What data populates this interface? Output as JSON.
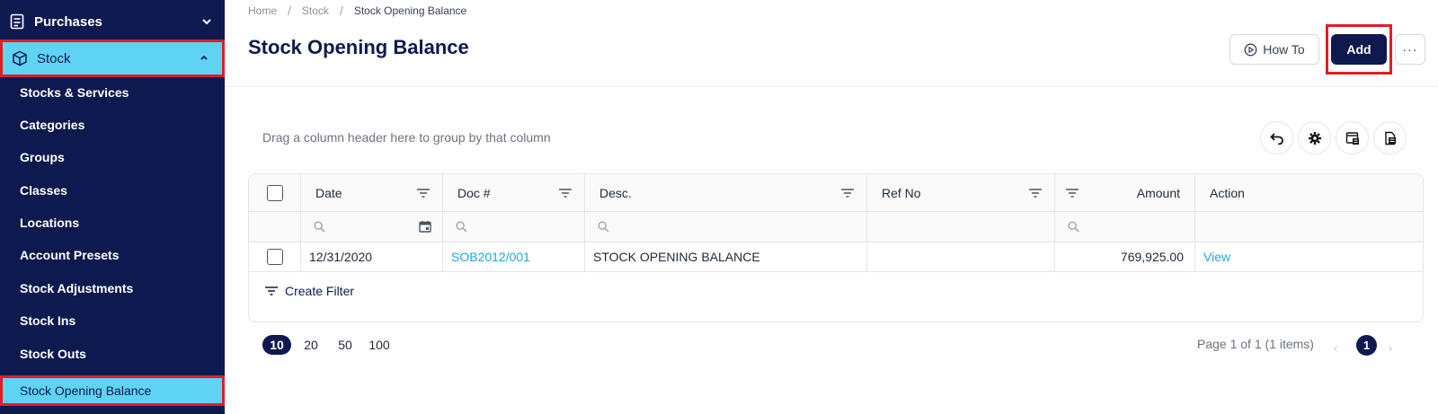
{
  "sidebar": {
    "purchases": "Purchases",
    "stock": "Stock",
    "items": [
      "Stocks & Services",
      "Categories",
      "Groups",
      "Classes",
      "Locations",
      "Account Presets",
      "Stock Adjustments",
      "Stock Ins",
      "Stock Outs",
      "Stock Opening Balance"
    ]
  },
  "breadcrumb": [
    "Home",
    "Stock",
    "Stock Opening Balance"
  ],
  "header": {
    "title": "Stock Opening Balance",
    "how_to": "How To",
    "add": "Add",
    "more": "···"
  },
  "grid": {
    "group_hint": "Drag a column header here to group by that column",
    "columns": [
      "Date",
      "Doc #",
      "Desc.",
      "Ref No",
      "Amount",
      "Action"
    ],
    "rows": [
      {
        "date": "12/31/2020",
        "doc": "SOB2012/001",
        "desc": "STOCK OPENING BALANCE",
        "ref": "",
        "amount": "769,925.00",
        "action": "View"
      }
    ],
    "create_filter": "Create Filter"
  },
  "pager": {
    "sizes": [
      "10",
      "20",
      "50",
      "100"
    ],
    "selected_size": "10",
    "info": "Page 1 of 1 (1 items)",
    "current_page": "1",
    "prev": "‹",
    "next": "›"
  },
  "colors": {
    "sidebar_bg": "#0e1a4f",
    "active_bg": "#5ed3f3",
    "highlight_border": "#e11d24",
    "link": "#1ea7e1"
  }
}
